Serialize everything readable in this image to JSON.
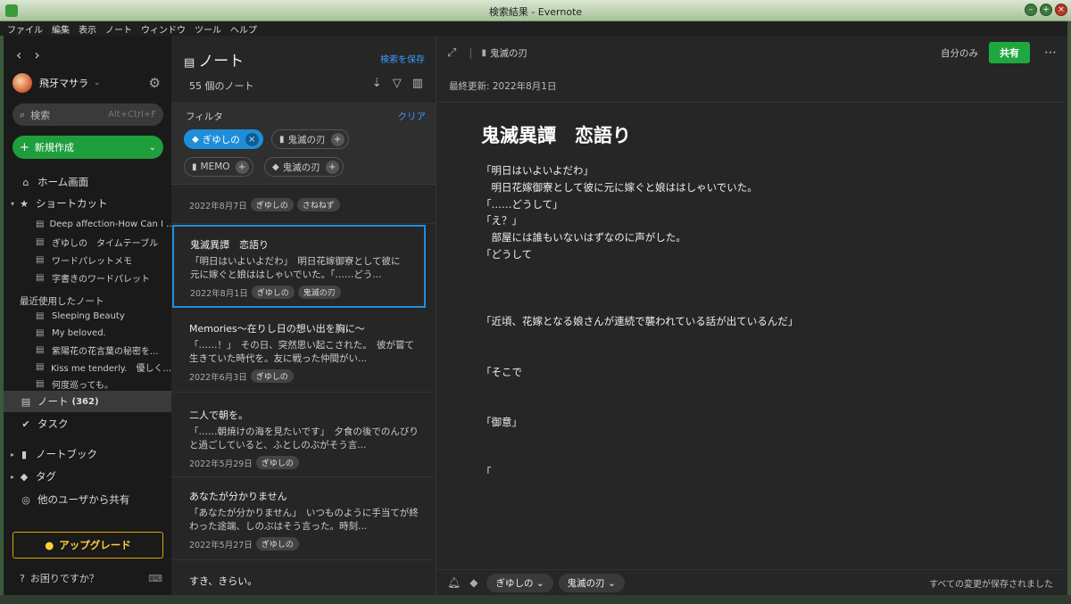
{
  "window": {
    "title": "検索結果 - Evernote"
  },
  "menu": [
    "ファイル",
    "編集",
    "表示",
    "ノート",
    "ウィンドウ",
    "ツール",
    "ヘルプ"
  ],
  "sidebar": {
    "user": "飛牙マサラ",
    "search_label": "検索",
    "search_shortcut": "Alt+Ctrl+F",
    "new_note": "新規作成",
    "home": "ホーム画面",
    "shortcuts": "ショートカット",
    "shortcut_items": [
      "Deep affection-How Can I ...",
      "ぎゆしの　タイムテーブル",
      "ワードパレットメモ",
      "字書きのワードパレット"
    ],
    "recent_heading": "最近使用したノート",
    "recent_items": [
      "Sleeping Beauty",
      "My beloved.",
      "紫陽花の花言葉の秘密を...",
      "Kiss me tenderly.　優しく...",
      "何度巡っても。"
    ],
    "notes": "ノート",
    "notes_count": "(362)",
    "tasks": "タスク",
    "notebooks": "ノートブック",
    "tags": "タグ",
    "shared": "他のユーザから共有",
    "upgrade": "アップグレード",
    "help": "お困りですか？"
  },
  "notelist": {
    "title": "ノート",
    "save_search": "検索を保存",
    "count": "55 個のノート",
    "filter_label": "フィルタ",
    "clear": "クリア",
    "chips": [
      "ぎゆしの",
      "鬼滅の刃",
      "MEMO",
      "鬼滅の刃"
    ],
    "notes": [
      {
        "title": "",
        "snippet": "",
        "date": "2022年8月7日",
        "tags": [
          "ぎゆしの",
          "さねねず"
        ]
      },
      {
        "title": "鬼滅異譚　恋語り",
        "snippet": "「明日はいよいよだわ」　明日花嫁御寮として彼に元に嫁ぐと娘ははしゃいでいた。「……どう...",
        "date": "2022年8月1日",
        "tags": [
          "ぎゆしの",
          "鬼滅の刃"
        ]
      },
      {
        "title": "Memories〜在りし日の想い出を胸に〜",
        "snippet": "「……！」　その日、突然思い起こされた。　彼が嘗て生きていた時代を。友に戦った仲間がい...",
        "date": "2022年6月3日",
        "tags": [
          "ぎゆしの"
        ]
      },
      {
        "title": "二人で朝を。",
        "snippet": "「……朝焼けの海を見たいです」　夕食の後でのんびりと過ごしていると、ふとしのぶがそう言...",
        "date": "2022年5月29日",
        "tags": [
          "ぎゆしの"
        ]
      },
      {
        "title": "あなたが分かりません",
        "snippet": "「あなたが分かりません」　いつものように手当てが終わった途端、しのぶはそう言った。時刻...",
        "date": "2022年5月27日",
        "tags": [
          "ぎゆしの"
        ]
      },
      {
        "title": "すき、きらい。",
        "snippet": "",
        "date": "",
        "tags": []
      }
    ]
  },
  "editor": {
    "notebook": "鬼滅の刃",
    "visibility": "自分のみ",
    "share": "共有",
    "last_updated": "最終更新: 2022年8月1日",
    "heading": "鬼滅異譚　恋語り",
    "lines": [
      "「明日はいよいよだわ」",
      "　明日花嫁御寮として彼に元に嫁ぐと娘ははしゃいでいた。",
      "「……どうして」",
      "「え？」",
      "　部屋には誰もいないはずなのに声がした。",
      "「どうして",
      "",
      "",
      "",
      "「近頃、花嫁となる娘さんが連続で襲われている話が出ているんだ」",
      "",
      "",
      "「そこで",
      "",
      "",
      "「御意」",
      "",
      "",
      "「"
    ],
    "tags": [
      "ぎゆしの",
      "鬼滅の刃"
    ],
    "saved": "すべての変更が保存されました"
  }
}
